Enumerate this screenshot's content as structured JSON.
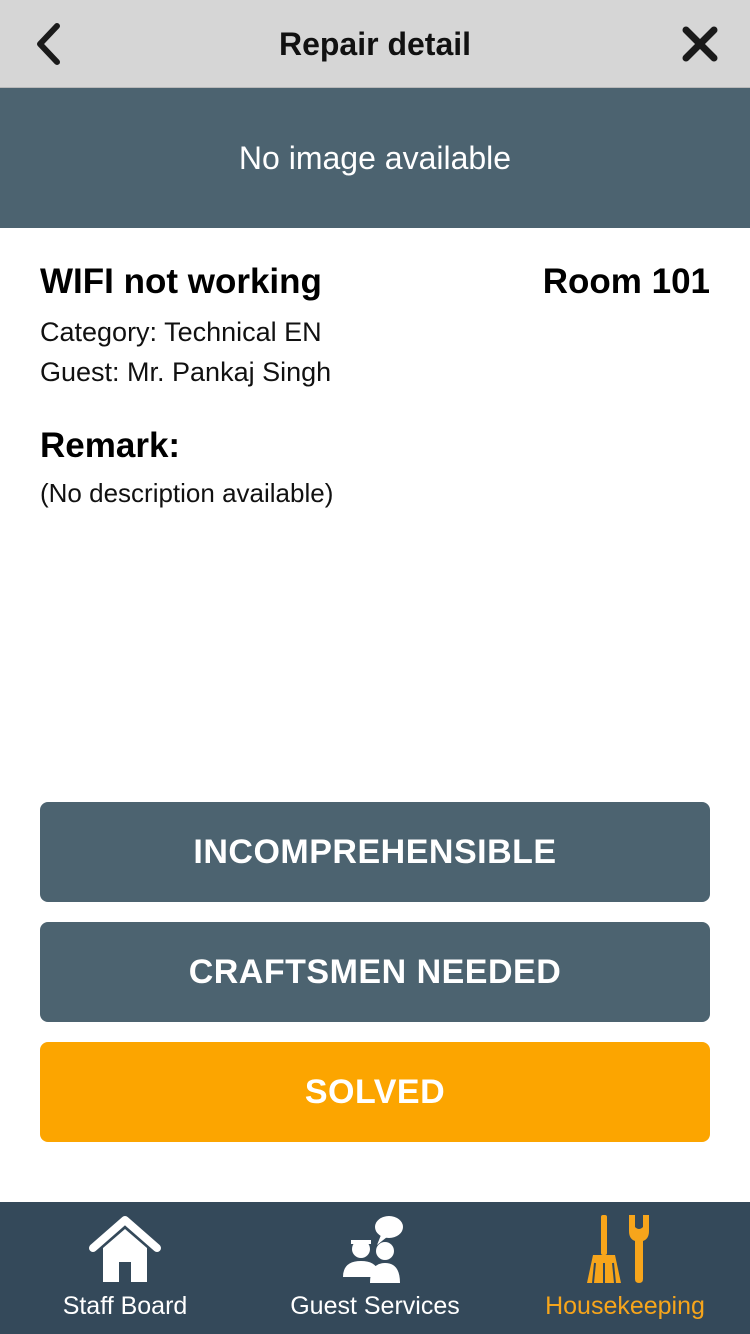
{
  "header": {
    "title": "Repair detail",
    "back_icon": "chevron-left-icon",
    "close_icon": "close-icon"
  },
  "image_banner": {
    "text": "No image available"
  },
  "repair": {
    "title": "WIFI not working",
    "room": "Room 101",
    "category": "Category: Technical EN",
    "guest": "Guest: Mr. Pankaj Singh",
    "remark_label": "Remark:",
    "remark_text": "(No description available)"
  },
  "actions": {
    "incomprehensible_label": "INCOMPREHENSIBLE",
    "craftsmen_label": "CRAFTSMEN NEEDED",
    "solved_label": "SOLVED"
  },
  "tabbar": {
    "items": [
      {
        "label": "Staff Board",
        "icon": "house-icon",
        "active": false
      },
      {
        "label": "Guest Services",
        "icon": "guest-chat-icon",
        "active": false
      },
      {
        "label": "Housekeeping",
        "icon": "broom-wrench-icon",
        "active": true
      }
    ]
  },
  "colors": {
    "header_bg": "#d6d6d6",
    "slate": "#4c6370",
    "accent_orange": "#fca500",
    "tabbar_bg": "#34495a",
    "tab_active": "#f7a51b"
  }
}
